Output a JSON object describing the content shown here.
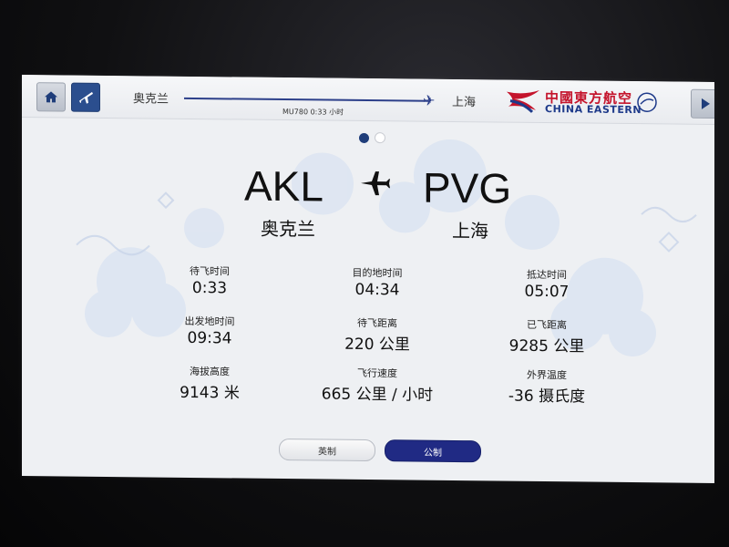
{
  "topbar": {
    "origin_city": "奥克兰",
    "dest_city": "上海",
    "flight_status": "MU780 0:33 小时",
    "logo_cn": "中國東方航空",
    "logo_en": "CHINA EASTERN",
    "icons": [
      "home-icon",
      "airplane-icon",
      "play-next-icon"
    ]
  },
  "page_indicator": {
    "total": 2,
    "active": 1
  },
  "route": {
    "origin_code": "AKL",
    "dest_code": "PVG",
    "origin_city": "奥克兰",
    "dest_city": "上海"
  },
  "stats": [
    {
      "label": "待飞时间",
      "value": "0:33"
    },
    {
      "label": "目的地时间",
      "value": "04:34"
    },
    {
      "label": "抵达时间",
      "value": "05:07"
    },
    {
      "label": "出发地时间",
      "value": "09:34"
    },
    {
      "label": "待飞距离",
      "value": "220 公里"
    },
    {
      "label": "已飞距离",
      "value": "9285 公里"
    },
    {
      "label": "海拔高度",
      "value": "9143 米"
    },
    {
      "label": "飞行速度",
      "value": "665 公里 / 小时"
    },
    {
      "label": "外界温度",
      "value": "-36 摄氏度"
    }
  ],
  "units": {
    "imperial_label": "英制",
    "metric_label": "公制",
    "selected": "公制"
  },
  "colors": {
    "accent_navy": "#1f3d7a",
    "brand_red": "#c4142c",
    "brand_blue": "#1e3a8a",
    "screen_bg": "#eef0f3"
  }
}
